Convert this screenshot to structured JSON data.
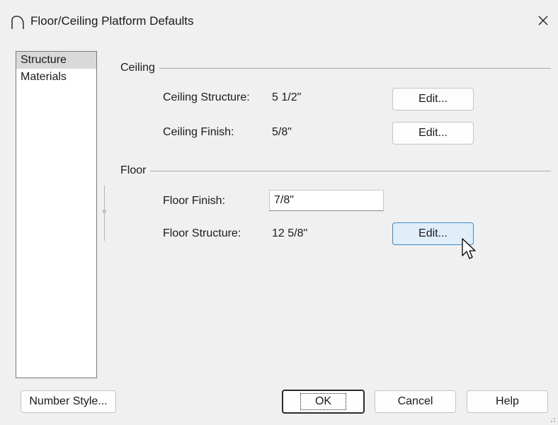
{
  "window": {
    "title": "Floor/Ceiling Platform Defaults"
  },
  "sidebar": {
    "items": [
      {
        "label": "Structure",
        "selected": true
      },
      {
        "label": "Materials",
        "selected": false
      }
    ]
  },
  "ceiling": {
    "heading": "Ceiling",
    "structure_label": "Ceiling Structure:",
    "structure_value": "5 1/2\"",
    "finish_label": "Ceiling Finish:",
    "finish_value": "5/8\"",
    "edit_label": "Edit..."
  },
  "floor": {
    "heading": "Floor",
    "finish_label": "Floor Finish:",
    "finish_value": "7/8\"",
    "structure_label": "Floor Structure:",
    "structure_value": "12 5/8\"",
    "edit_label": "Edit..."
  },
  "footer": {
    "number_style_label": "Number Style...",
    "ok_label": "OK",
    "cancel_label": "Cancel",
    "help_label": "Help"
  },
  "colors": {
    "hover_fill": "#e0eef9",
    "hover_border": "#3c88c6",
    "selected_item": "#d9d9d9"
  }
}
